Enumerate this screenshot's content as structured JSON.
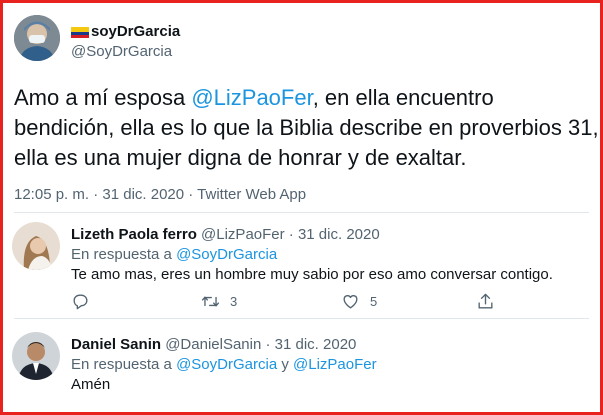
{
  "tweet": {
    "author_name": "soyDrGarcia",
    "author_handle": "@SoyDrGarcia",
    "text_before": "Amo a mí esposa ",
    "text_mention": "@LizPaoFer",
    "text_after": ", en ella encuentro bendición, ella es lo que la Biblia describe en proverbios 31, ella es una mujer digna de honrar y de exaltar.",
    "meta": "12:05 p. m. · 31 dic. 2020 · Twitter Web App"
  },
  "replies": [
    {
      "name": "Lizeth Paola ferro",
      "handle_date": "@LizPaoFer · 31 dic. 2020",
      "reply_prefix": "En respuesta a ",
      "reply_mention_1": "@SoyDrGarcia",
      "reply_join": "",
      "reply_mention_2": "",
      "text": "Te amo mas,  eres un hombre muy sabio por eso amo conversar contigo.",
      "retweets": "3",
      "likes": "5"
    },
    {
      "name": "Daniel Sanin",
      "handle_date": "@DanielSanin · 31 dic. 2020",
      "reply_prefix": "En respuesta a ",
      "reply_mention_1": "@SoyDrGarcia",
      "reply_join": " y ",
      "reply_mention_2": "@LizPaoFer",
      "text": "Amén"
    }
  ],
  "icons": {
    "reply": "reply-icon",
    "retweet": "retweet-icon",
    "like": "heart-icon",
    "share": "share-icon"
  },
  "colors": {
    "frame": "#e8231f",
    "link": "#1b95e0",
    "muted": "#536471"
  }
}
